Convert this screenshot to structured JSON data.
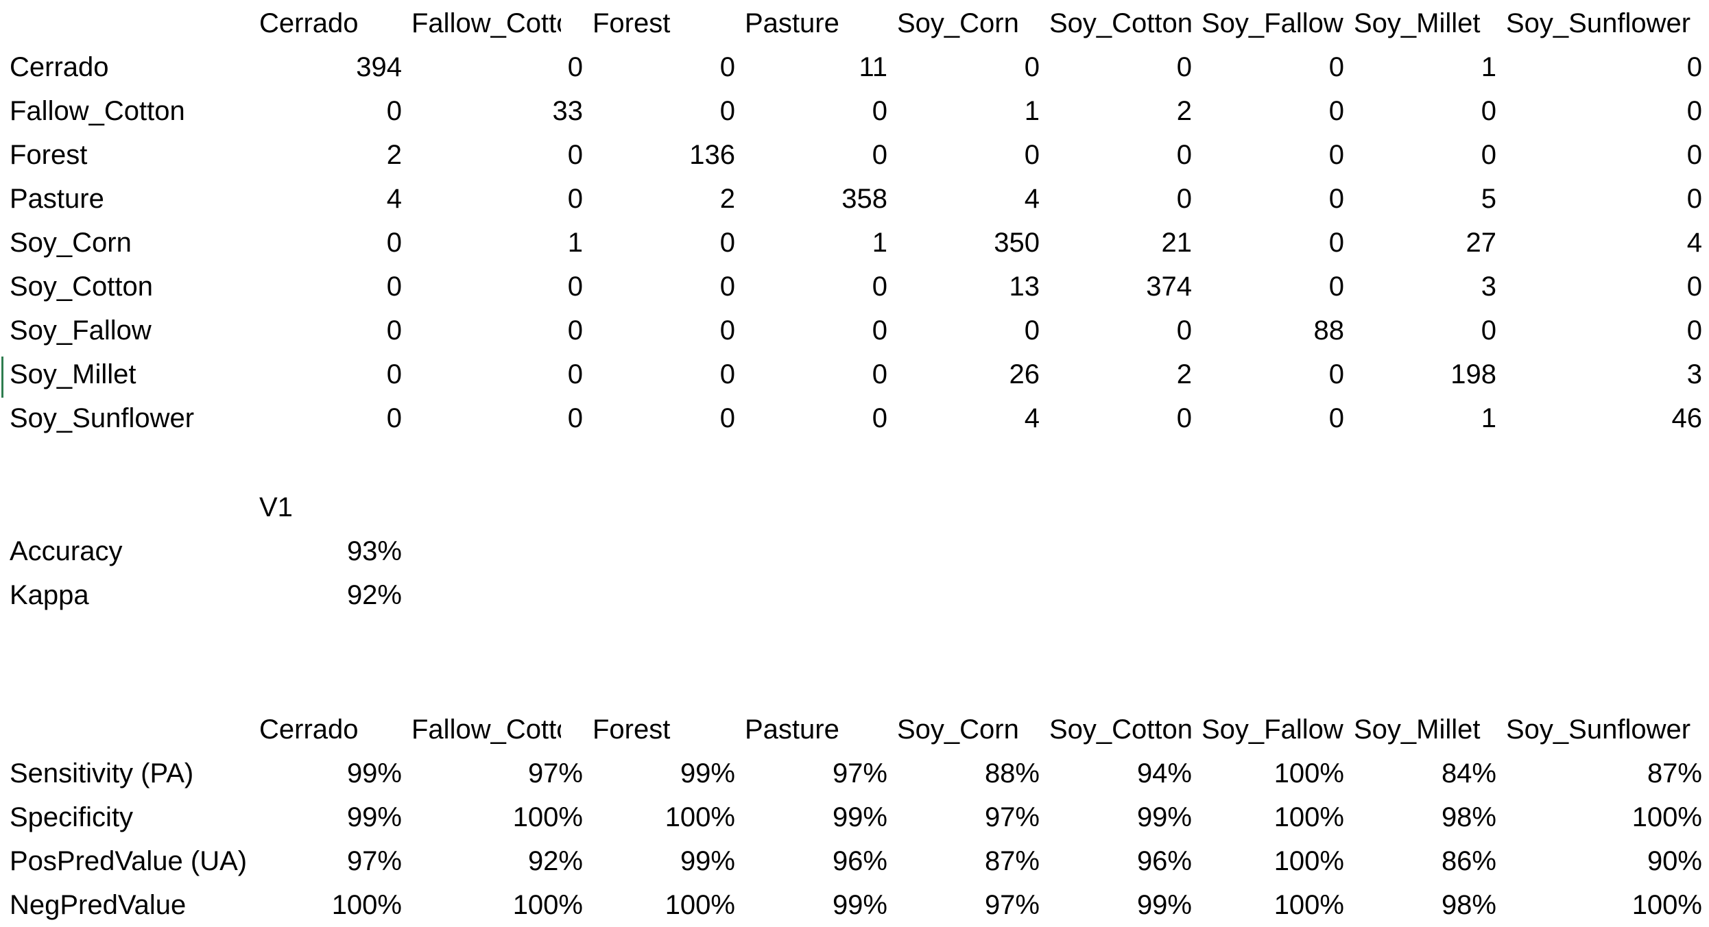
{
  "confusion_matrix": {
    "headers": [
      "Cerrado",
      "Fallow_Cottor",
      "Forest",
      "Pasture",
      "Soy_Corn",
      "Soy_Cotton",
      "Soy_Fallow",
      "Soy_Millet",
      "Soy_Sunflower"
    ],
    "rows": [
      {
        "label": "Cerrado",
        "values": [
          "394",
          "0",
          "0",
          "11",
          "0",
          "0",
          "0",
          "1",
          "0"
        ]
      },
      {
        "label": "Fallow_Cotton",
        "values": [
          "0",
          "33",
          "0",
          "0",
          "1",
          "2",
          "0",
          "0",
          "0"
        ]
      },
      {
        "label": "Forest",
        "values": [
          "2",
          "0",
          "136",
          "0",
          "0",
          "0",
          "0",
          "0",
          "0"
        ]
      },
      {
        "label": "Pasture",
        "values": [
          "4",
          "0",
          "2",
          "358",
          "4",
          "0",
          "0",
          "5",
          "0"
        ]
      },
      {
        "label": "Soy_Corn",
        "values": [
          "0",
          "1",
          "0",
          "1",
          "350",
          "21",
          "0",
          "27",
          "4"
        ]
      },
      {
        "label": "Soy_Cotton",
        "values": [
          "0",
          "0",
          "0",
          "0",
          "13",
          "374",
          "0",
          "3",
          "0"
        ]
      },
      {
        "label": "Soy_Fallow",
        "values": [
          "0",
          "0",
          "0",
          "0",
          "0",
          "0",
          "88",
          "0",
          "0"
        ]
      },
      {
        "label": "Soy_Millet",
        "values": [
          "0",
          "0",
          "0",
          "0",
          "26",
          "2",
          "0",
          "198",
          "3"
        ]
      },
      {
        "label": "Soy_Sunflower",
        "values": [
          "0",
          "0",
          "0",
          "0",
          "4",
          "0",
          "0",
          "1",
          "46"
        ]
      }
    ]
  },
  "overall": {
    "header": "V1",
    "rows": [
      {
        "label": "Accuracy",
        "value": "93%"
      },
      {
        "label": "Kappa",
        "value": "92%"
      }
    ]
  },
  "class_stats": {
    "headers": [
      "Cerrado",
      "Fallow_Cottor",
      "Forest",
      "Pasture",
      "Soy_Corn",
      "Soy_Cotton",
      "Soy_Fallow",
      "Soy_Millet",
      "Soy_Sunflower"
    ],
    "rows": [
      {
        "label": "Sensitivity (PA)",
        "values": [
          "99%",
          "97%",
          "99%",
          "97%",
          "88%",
          "94%",
          "100%",
          "84%",
          "87%"
        ]
      },
      {
        "label": "Specificity",
        "values": [
          "99%",
          "100%",
          "100%",
          "99%",
          "97%",
          "99%",
          "100%",
          "98%",
          "100%"
        ]
      },
      {
        "label": "PosPredValue (UA)",
        "values": [
          "97%",
          "92%",
          "99%",
          "96%",
          "87%",
          "96%",
          "100%",
          "86%",
          "90%"
        ]
      },
      {
        "label": "NegPredValue",
        "values": [
          "100%",
          "100%",
          "100%",
          "99%",
          "97%",
          "99%",
          "100%",
          "98%",
          "100%"
        ]
      }
    ]
  }
}
